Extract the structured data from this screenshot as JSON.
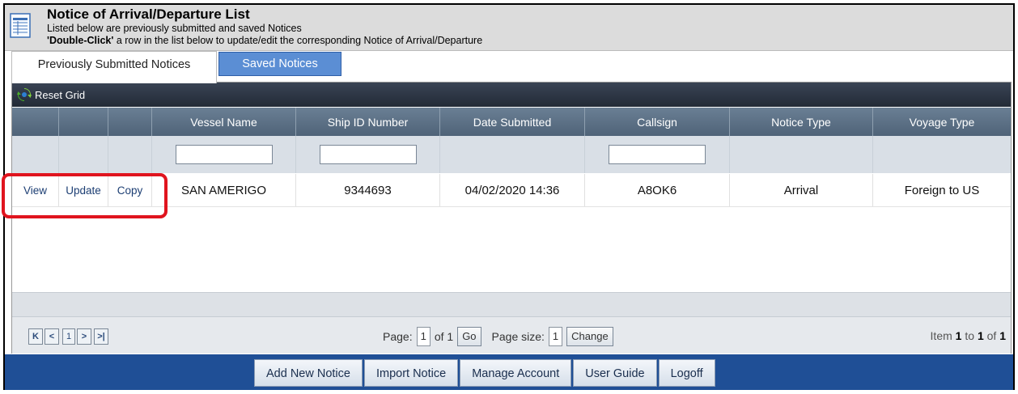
{
  "header": {
    "title": "Notice of Arrival/Departure List",
    "line1": "Listed below are previously submitted and saved Notices",
    "line2_bold": "'Double-Click'",
    "line2_rest": " a row in the list below to update/edit the corresponding Notice of Arrival/Departure"
  },
  "tabs": {
    "active": "Previously Submitted Notices",
    "inactive": "Saved Notices"
  },
  "toolbar": {
    "reset_label": "Reset Grid"
  },
  "columns": [
    "",
    "",
    "",
    "Vessel Name",
    "Ship ID Number",
    "Date Submitted",
    "Callsign",
    "Notice Type",
    "Voyage Type"
  ],
  "row": {
    "view": "View",
    "update": "Update",
    "copy": "Copy",
    "vessel_name": "SAN AMERIGO",
    "ship_id": "9344693",
    "date_submitted": "04/02/2020 14:36",
    "callsign": "A8OK6",
    "notice_type": "Arrival",
    "voyage_type": "Foreign to US"
  },
  "pager": {
    "first": "K",
    "prev": "<",
    "page_num": "1",
    "next": ">",
    "last": ">|",
    "page_label": "Page:",
    "page_value": "1",
    "of_label": "of 1",
    "go_label": "Go",
    "size_label": "Page size:",
    "size_value": "1",
    "change_label": "Change",
    "item_prefix": "Item",
    "item_from": "1",
    "item_to_label": "to",
    "item_to": "1",
    "item_of_label": "of",
    "item_total": "1"
  },
  "footer": {
    "add": "Add New Notice",
    "import": "Import Notice",
    "manage": "Manage Account",
    "guide": "User Guide",
    "logoff": "Logoff"
  },
  "colors": {
    "footer_bg": "#1f4f96",
    "highlight": "#e0141e",
    "tab_active_bg": "#5b8ed4"
  }
}
